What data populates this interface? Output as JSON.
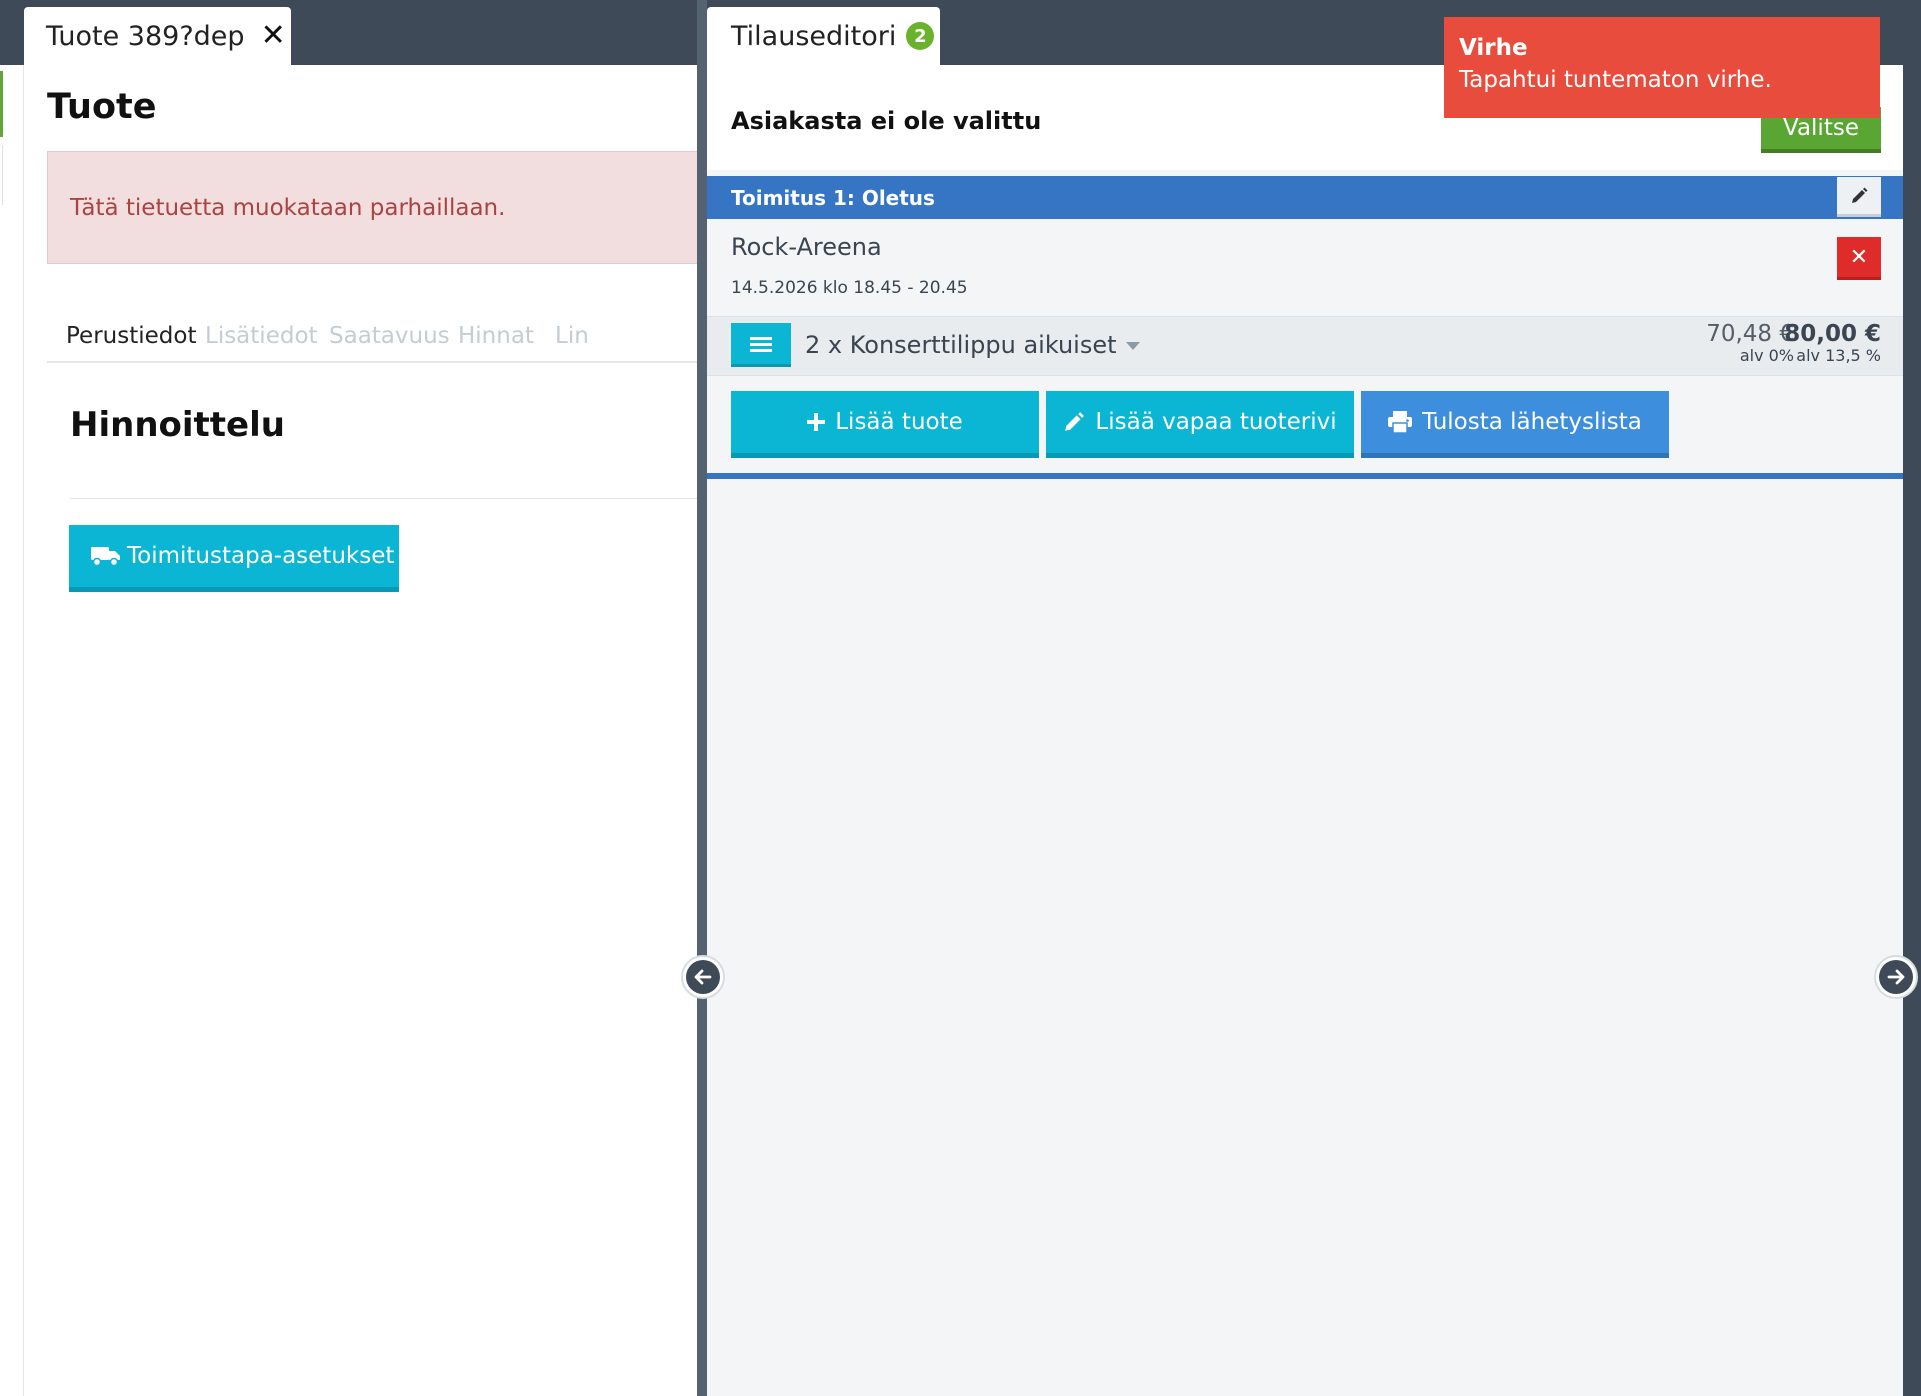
{
  "left": {
    "tab_title": "Tuote 389?dep",
    "page_title": "Tuote",
    "alert_text": "Tätä tietuetta muokataan parhaillaan.",
    "tabs": [
      {
        "label": "Perustiedot",
        "active": true
      },
      {
        "label": "Lisätiedot",
        "active": false
      },
      {
        "label": "Saatavuus",
        "active": false
      },
      {
        "label": "Hinnat",
        "active": false
      },
      {
        "label": "Lin",
        "active": false
      }
    ],
    "section_title": "Hinnoittelu",
    "shipping_button_label": "Toimitustapa-asetukset"
  },
  "right": {
    "tab_title": "Tilauseditori",
    "tab_count": "2",
    "customer_title": "Asiakasta ei ole valittu",
    "select_button_label": "Valitse",
    "delivery_header": "Toimitus 1: Oletus",
    "event_name": "Rock-Areena",
    "event_time": "14.5.2026 klo 18.45 - 20.45",
    "line": {
      "label": "2 x Konserttilippu aikuiset",
      "price_net": "70,48 €",
      "vat_net": "alv 0%",
      "price_gross": "80,00 €",
      "vat_gross": "alv 13,5 %"
    },
    "actions": {
      "add_product": "Lisää tuote",
      "add_free_row": "Lisää vapaa tuoterivi",
      "print_list": "Tulosta lähetyslista"
    }
  },
  "toast": {
    "title": "Virhe",
    "message": "Tapahtui tuntematon virhe."
  },
  "colors": {
    "accent_cyan": "#0bb6d4",
    "accent_blue": "#3575c4",
    "success_green": "#5aa632",
    "danger_red": "#e02b2b",
    "toast_red": "#e74c3c"
  }
}
